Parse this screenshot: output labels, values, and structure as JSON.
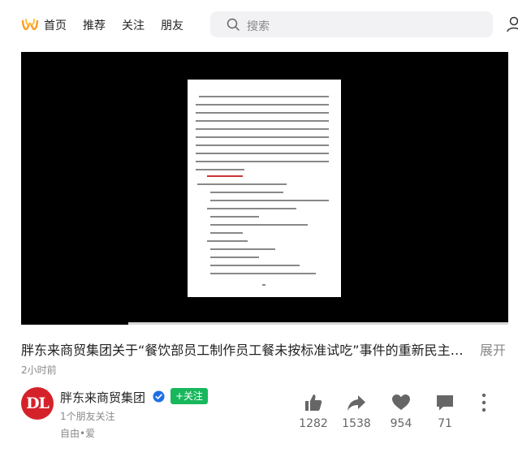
{
  "nav": {
    "items": [
      "首页",
      "推荐",
      "关注",
      "朋友"
    ]
  },
  "search": {
    "placeholder": "搜索"
  },
  "video": {
    "progress": 0.22
  },
  "post": {
    "title": "胖东来商贸集团关于“餐饮部员工制作员工餐未按标准试吃”事件的重新民主…",
    "expand_label": "展开",
    "time": "2小时前"
  },
  "author": {
    "avatar_text": "DL",
    "name": "胖东来商贸集团",
    "follow_label": "+关注",
    "friends_following": "1个朋友关注",
    "tag": "自由•爱"
  },
  "actions": {
    "like_count": "1282",
    "share_count": "1538",
    "favorite_count": "954",
    "comment_count": "71"
  },
  "colors": {
    "brand": "#ff9a1f",
    "follow": "#17b85c",
    "verified": "#1e6fe6",
    "avatar": "#d5222a"
  }
}
